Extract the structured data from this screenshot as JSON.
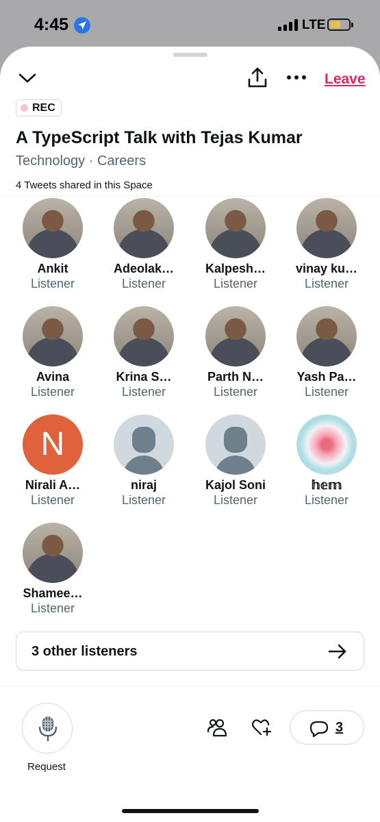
{
  "status_bar": {
    "time": "4:45",
    "network": "LTE"
  },
  "header": {
    "leave_label": "Leave"
  },
  "rec_badge": {
    "label": "REC"
  },
  "space": {
    "title": "A TypeScript Talk with Tejas Kumar",
    "topics": "Technology · Careers",
    "tweets_shared": "4 Tweets shared in this Space"
  },
  "participants": [
    {
      "name": "Ankit",
      "role": "Listener",
      "avatar": "photo"
    },
    {
      "name": "Adeolak…",
      "role": "Listener",
      "avatar": "photo"
    },
    {
      "name": "Kalpesh…",
      "role": "Listener",
      "avatar": "photo"
    },
    {
      "name": "vinay ku…",
      "role": "Listener",
      "avatar": "photo"
    },
    {
      "name": "Avina",
      "role": "Listener",
      "avatar": "photo"
    },
    {
      "name": "Krina S…",
      "role": "Listener",
      "avatar": "photo"
    },
    {
      "name": "Parth N…",
      "role": "Listener",
      "avatar": "photo"
    },
    {
      "name": "Yash Pa…",
      "role": "Listener",
      "avatar": "photo"
    },
    {
      "name": "Nirali A…",
      "role": "Listener",
      "avatar": "initial",
      "initial": "N"
    },
    {
      "name": "niraj",
      "role": "Listener",
      "avatar": "default"
    },
    {
      "name": "Kajol Soni",
      "role": "Listener",
      "avatar": "default"
    },
    {
      "name": "𝕙𝕖𝕞",
      "role": "Listener",
      "avatar": "orb"
    },
    {
      "name": "Shamee…",
      "role": "Listener",
      "avatar": "photo"
    }
  ],
  "other_listeners": {
    "label": "3 other listeners"
  },
  "bottom_bar": {
    "request_label": "Request",
    "comments_count": "3"
  },
  "colors": {
    "accent_red": "#e0245e",
    "secondary_text": "#536471",
    "border": "#cfd9de"
  }
}
